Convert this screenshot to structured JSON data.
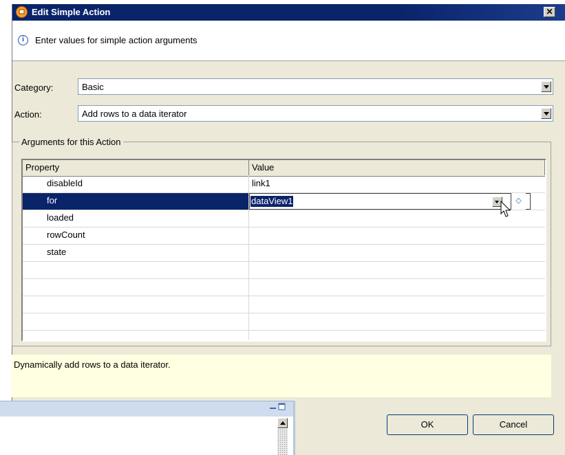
{
  "dialog": {
    "title": "Edit Simple Action",
    "close_glyph": "✕",
    "info_text": "Enter values for simple action arguments"
  },
  "form": {
    "category_label": "Category:",
    "category_value": "Basic",
    "action_label": "Action:",
    "action_value": "Add rows to a data iterator"
  },
  "arguments": {
    "group_title": "Arguments for this Action",
    "columns": [
      "Property",
      "Value"
    ],
    "rows": [
      {
        "property": "disableId",
        "value": "link1"
      },
      {
        "property": "for",
        "value": "dataView1"
      },
      {
        "property": "loaded",
        "value": ""
      },
      {
        "property": "rowCount",
        "value": ""
      },
      {
        "property": "state",
        "value": ""
      }
    ],
    "selected_row": 1
  },
  "description": "Dynamically add rows to a data iterator.",
  "buttons": {
    "ok": "OK",
    "cancel": "Cancel"
  },
  "colors": {
    "title_bar": "#0a246a",
    "dialog_bg": "#ece9d8",
    "description_bg": "#ffffe1",
    "selection": "#0a246a"
  },
  "icons": [
    "app-icon",
    "info-icon",
    "close-icon",
    "dropdown-icon",
    "diamond-icon",
    "cursor-icon",
    "minimize-icon",
    "maximize-icon",
    "scroll-up-icon"
  ]
}
